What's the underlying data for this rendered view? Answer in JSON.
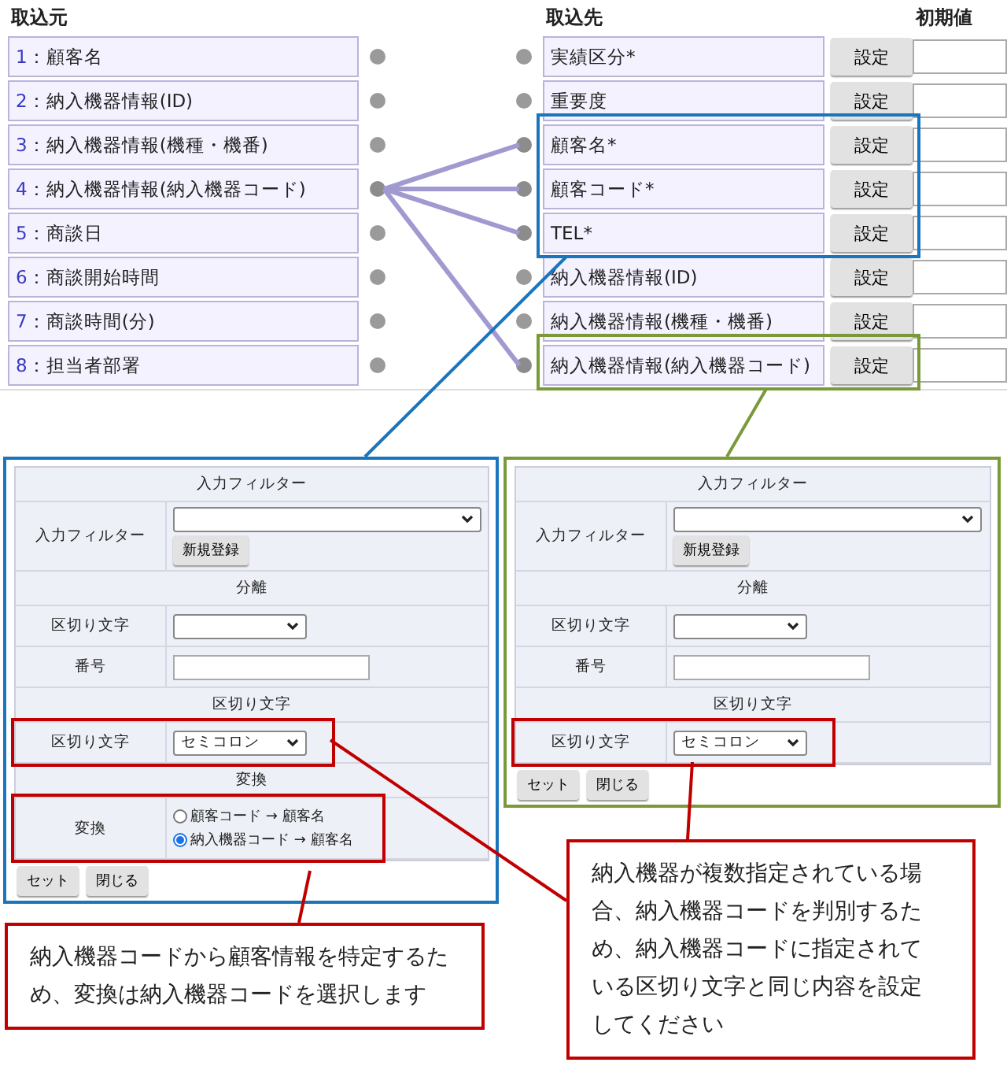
{
  "source_header": "取込元",
  "target_header": "取込先",
  "default_header": "初期値",
  "source_fields": [
    {
      "number": "1",
      "label": "：顧客名",
      "linked": false
    },
    {
      "number": "2",
      "label": "：納入機器情報(ID)",
      "linked": false
    },
    {
      "number": "3",
      "label": "：納入機器情報(機種・機番)",
      "linked": false
    },
    {
      "number": "4",
      "label": "：納入機器情報(納入機器コード)",
      "linked": true
    },
    {
      "number": "5",
      "label": "：商談日",
      "linked": false
    },
    {
      "number": "6",
      "label": "：商談開始時間",
      "linked": false
    },
    {
      "number": "7",
      "label": "：商談時間(分)",
      "linked": false
    },
    {
      "number": "8",
      "label": "：担当者部署",
      "linked": false
    }
  ],
  "target_fields": [
    {
      "label": "実績区分*",
      "button": "設定",
      "linked": false
    },
    {
      "label": "重要度",
      "button": "設定",
      "linked": false
    },
    {
      "label": "顧客名*",
      "button": "設定",
      "linked": true,
      "color": "#1b75bc"
    },
    {
      "label": "顧客コード*",
      "button": "設定",
      "linked": true,
      "color": "#1b75bc"
    },
    {
      "label": "TEL*",
      "button": "設定",
      "linked": true,
      "color": "#1b75bc"
    },
    {
      "label": "納入機器情報(ID)",
      "button": "設定",
      "linked": false
    },
    {
      "label": "納入機器情報(機種・機番)",
      "button": "設定",
      "linked": false
    },
    {
      "label": "納入機器情報(納入機器コード)",
      "button": "設定",
      "linked": true,
      "color": "#7a9a3a"
    }
  ],
  "panels": [
    {
      "color": "#1b75bc",
      "rows": [
        {
          "kind": "header",
          "label": "入力フィルター"
        },
        {
          "kind": "select_with_button",
          "label": "入力フィルター",
          "button": "新規登録",
          "highlighted": false
        },
        {
          "kind": "header",
          "label": "分離"
        },
        {
          "kind": "select",
          "label": "区切り文字",
          "highlighted": false
        },
        {
          "kind": "text",
          "label": "番号",
          "highlighted": false
        },
        {
          "kind": "header",
          "label": "区切り文字"
        },
        {
          "kind": "select",
          "label": "区切り文字",
          "value": "セミコロン",
          "highlighted": true
        },
        {
          "kind": "header",
          "label": "変換"
        },
        {
          "kind": "radio",
          "label": "変換",
          "highlighted": true,
          "options": [
            {
              "label": "顧客コード → 顧客名",
              "selected": false
            },
            {
              "label": "納入機器コード → 顧客名",
              "selected": true
            }
          ]
        }
      ],
      "buttons": [
        "セット",
        "閉じる"
      ]
    },
    {
      "color": "#7a9a3a",
      "rows": [
        {
          "kind": "header",
          "label": "入力フィルター"
        },
        {
          "kind": "select_with_button",
          "label": "入力フィルター",
          "button": "新規登録",
          "highlighted": false
        },
        {
          "kind": "header",
          "label": "分離"
        },
        {
          "kind": "select",
          "label": "区切り文字",
          "highlighted": false
        },
        {
          "kind": "text",
          "label": "番号",
          "highlighted": false
        },
        {
          "kind": "header",
          "label": "区切り文字"
        },
        {
          "kind": "select",
          "label": "区切り文字",
          "value": "セミコロン",
          "highlighted": true
        }
      ],
      "buttons": [
        "セット",
        "閉じる"
      ]
    }
  ],
  "callouts": [
    {
      "text": "納入機器コードから顧客情報を特定するため、変換は納入機器コードを選択します"
    },
    {
      "text": "納入機器が複数指定されている場合、納入機器コードを判別するため、納入機器コードに指定されている区切り文字と同じ内容を設定してください"
    }
  ]
}
